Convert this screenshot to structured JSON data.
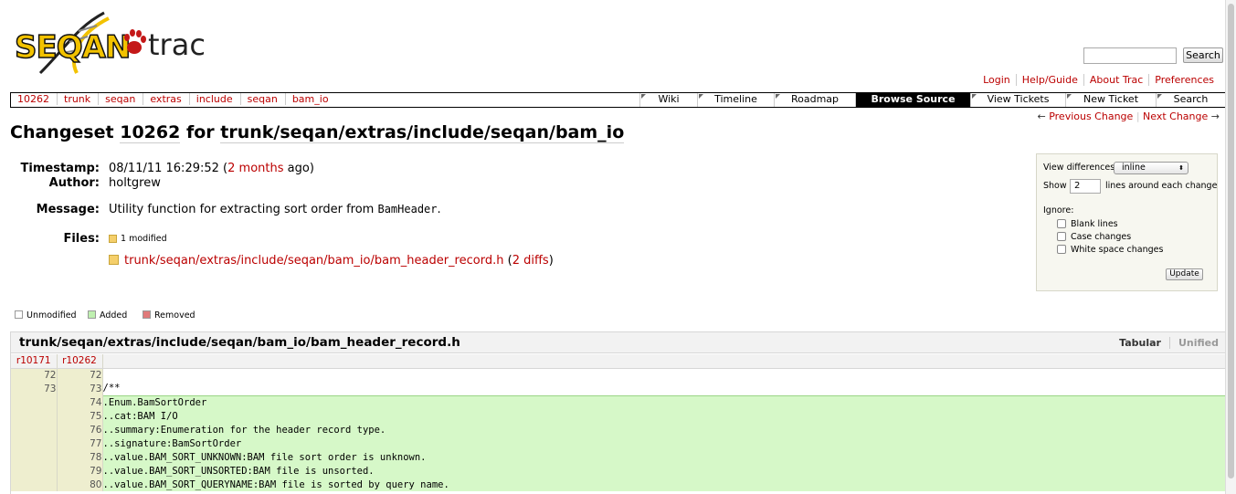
{
  "logo": {
    "text": "SEQAN",
    "trac": "trac"
  },
  "search": {
    "button": "Search",
    "value": ""
  },
  "metanav": [
    "Login",
    "Help/Guide",
    "About Trac",
    "Preferences"
  ],
  "breadcrumbs": [
    "10262",
    "trunk",
    "seqan",
    "extras",
    "include",
    "seqan",
    "bam_io"
  ],
  "mainnav": [
    {
      "label": "Wiki",
      "active": false
    },
    {
      "label": "Timeline",
      "active": false
    },
    {
      "label": "Roadmap",
      "active": false
    },
    {
      "label": "Browse Source",
      "active": true
    },
    {
      "label": "View Tickets",
      "active": false
    },
    {
      "label": "New Ticket",
      "active": false
    },
    {
      "label": "Search",
      "active": false
    }
  ],
  "ctxnav": {
    "prev": "Previous Change",
    "next": "Next Change",
    "prev_arrow": "←",
    "next_arrow": "→"
  },
  "title": {
    "prefix": "Changeset",
    "rev": "10262",
    "mid": "for",
    "path": "trunk/seqan/extras/include/seqan/bam_io"
  },
  "props": {
    "timestamp_label": "Timestamp:",
    "timestamp": "08/11/11 16:29:52",
    "age": "2 months",
    "age_suffix": "ago)",
    "author_label": "Author:",
    "author": "holtgrew",
    "message_label": "Message:",
    "message": "Utility function for extracting sort order from",
    "message_code": "BamHeader",
    "files_label": "Files:",
    "files_summary": "1 modified",
    "file_path": "trunk/seqan/extras/include/seqan/bam_io/bam_header_record.h",
    "file_diffs": "2 diffs"
  },
  "prefs": {
    "view_label": "View differences",
    "view_value": "inline",
    "show_label": "Show",
    "lines_value": "2",
    "lines_suffix": "lines around each change",
    "ignore_label": "Ignore:",
    "options": [
      "Blank lines",
      "Case changes",
      "White space changes"
    ],
    "update": "Update"
  },
  "legend": [
    {
      "label": "Unmodified",
      "color": "#ffffff"
    },
    {
      "label": "Added",
      "color": "#bff0b0"
    },
    {
      "label": "Removed",
      "color": "#e07a7a"
    }
  ],
  "diff": {
    "file": "trunk/seqan/extras/include/seqan/bam_io/bam_header_record.h",
    "tab_tabular": "Tabular",
    "tab_unified": "Unified",
    "old_rev": "r10171",
    "new_rev": "r10262",
    "rows": [
      {
        "old": "72",
        "new": "72",
        "code": "",
        "type": "ctx"
      },
      {
        "old": "73",
        "new": "73",
        "code": "/**",
        "type": "ctx"
      },
      {
        "old": "",
        "new": "74",
        "code": ".Enum.BamSortOrder",
        "type": "add"
      },
      {
        "old": "",
        "new": "75",
        "code": "..cat:BAM I/O",
        "type": "add"
      },
      {
        "old": "",
        "new": "76",
        "code": "..summary:Enumeration for the header record type.",
        "type": "add"
      },
      {
        "old": "",
        "new": "77",
        "code": "..signature:BamSortOrder",
        "type": "add"
      },
      {
        "old": "",
        "new": "78",
        "code": "..value.BAM_SORT_UNKNOWN:BAM file sort order is unknown.",
        "type": "add"
      },
      {
        "old": "",
        "new": "79",
        "code": "..value.BAM_SORT_UNSORTED:BAM file is unsorted.",
        "type": "add"
      },
      {
        "old": "",
        "new": "80",
        "code": "..value.BAM_SORT_QUERYNAME:BAM file is sorted by query name.",
        "type": "add"
      }
    ]
  }
}
